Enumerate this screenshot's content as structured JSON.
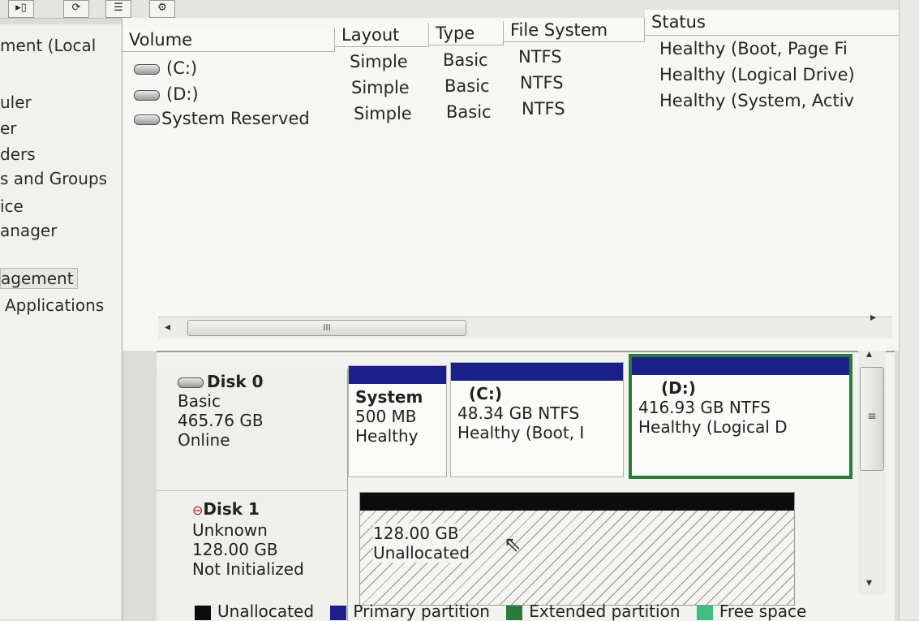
{
  "tree": {
    "items": [
      "ment (Local",
      "uler",
      "er",
      "ders",
      "s and Groups",
      "ice",
      "anager",
      "agement",
      "Applications"
    ]
  },
  "volume_list": {
    "columns": [
      "Volume",
      "Layout",
      "Type",
      "File System",
      "Status"
    ],
    "rows": [
      {
        "volume": "(C:)",
        "layout": "Simple",
        "type": "Basic",
        "fs": "NTFS",
        "status": "Healthy (Boot, Page Fi"
      },
      {
        "volume": "(D:)",
        "layout": "Simple",
        "type": "Basic",
        "fs": "NTFS",
        "status": "Healthy (Logical Drive)"
      },
      {
        "volume": "System Reserved",
        "layout": "Simple",
        "type": "Basic",
        "fs": "NTFS",
        "status": "Healthy (System, Activ"
      }
    ],
    "hscroll_thumb_label": "III"
  },
  "disks": [
    {
      "name": "Disk 0",
      "kind": "Basic",
      "size": "465.76 GB",
      "state": "Online",
      "partitions": [
        {
          "label": "System",
          "size": "500 MB",
          "status": "Healthy"
        },
        {
          "label": "(C:)",
          "size": "48.34 GB NTFS",
          "status": "Healthy (Boot, I"
        },
        {
          "label": "(D:)",
          "size": "416.93 GB NTFS",
          "status": "Healthy (Logical D"
        }
      ]
    },
    {
      "name": "Disk 1",
      "kind": "Unknown",
      "size": "128.00 GB",
      "state": "Not Initialized",
      "partitions": [
        {
          "size": "128.00 GB",
          "status": "Unallocated"
        }
      ]
    }
  ],
  "legend": [
    {
      "label": "Unallocated",
      "color": "#0b0b0b"
    },
    {
      "label": "Primary partition",
      "color": "#1a1f8a"
    },
    {
      "label": "Extended partition",
      "color": "#2c7a3a"
    },
    {
      "label": "Free space",
      "color": "#3fbf7f"
    }
  ]
}
